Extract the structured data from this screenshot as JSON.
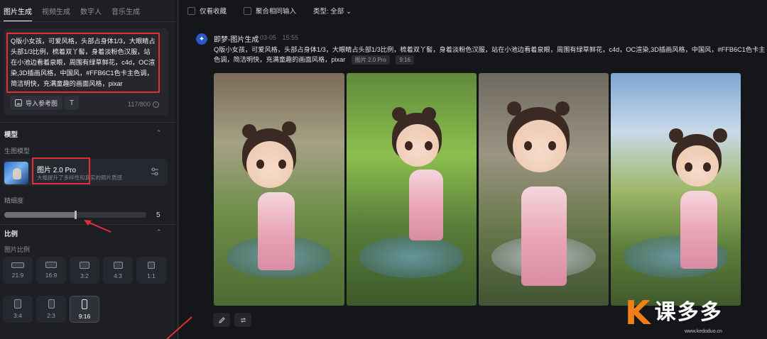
{
  "left_panel": {
    "tabs": [
      "图片生成",
      "视频生成",
      "数字人",
      "音乐生成"
    ],
    "prompt": "Q版小女孩，可爱风格，头部占身体1/3，大眼睛占头部1/3比例，梳着双丫髻，身着淡粉色汉服，站在小池边看着泉眼，周围有绿草鲜花，c4d，OC渲染,3D插画风格，中国风，#FFB6C1色卡主色调，简洁明快，充满童趣的画面风格，pixar",
    "import_ref_label": "导入参考图",
    "tt_label": "T",
    "char_count": "117/800",
    "model_section_title": "模型",
    "model_sub_label": "生图模型",
    "model_name": "图片 2.0 Pro",
    "model_desc": "大幅提升了多样性和真实的照片质感",
    "detail_label": "精细度",
    "detail_value": "5",
    "detail_level": 0.5,
    "ratio_section_title": "比例",
    "ratio_sub_label": "图片比例",
    "ratios": [
      "21:9",
      "16:9",
      "3:2",
      "4:3",
      "1:1",
      "3:4",
      "2:3",
      "9:16"
    ],
    "ratio_selected": "9:16"
  },
  "filter_bar": {
    "favorites_only": "仅看收藏",
    "aggregate_input": "聚合相同输入",
    "type_label": "类型: 全部"
  },
  "generation": {
    "title": "即梦-图片生成",
    "date": "03-05",
    "time": "15:55",
    "prompt": "Q版小女孩，可爱风格，头部占身体1/3，大眼睛占头部1/3比例，梳着双丫髻，身着淡粉色汉服，站在小池边看着泉眼，周围有绿草鲜花，c4d，OC渲染,3D插画风格，中国风，#FFB6C1色卡主色调，简洁明快，充满童趣的画面风格，pixar",
    "model_tag": "图片 2.0 Pro",
    "ratio_tag": "9:16"
  },
  "watermark": {
    "brand": "课多多",
    "url": "www.kedoduo.cn"
  },
  "colors": {
    "highlight_red": "#e02f3a",
    "accent_blue": "#2a56c7",
    "watermark_orange": "#f07f1a"
  }
}
